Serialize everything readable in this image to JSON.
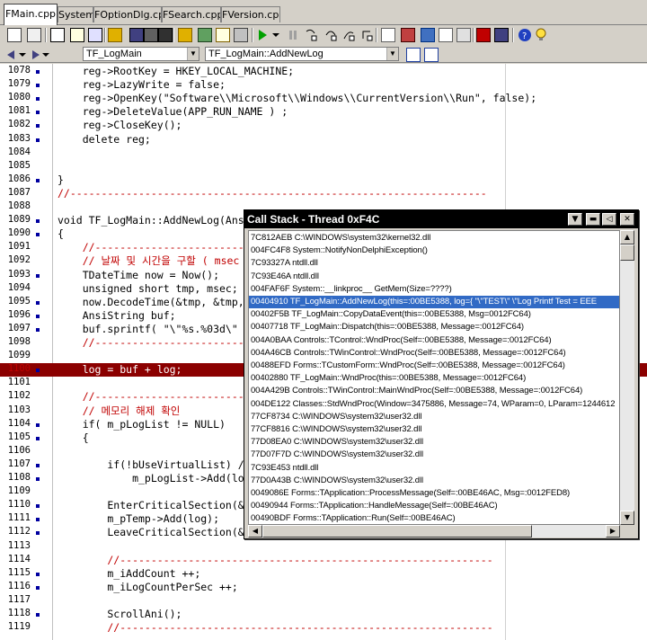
{
  "tabs": [
    "FMain.cpp",
    "System",
    "FOptionDlg.cpp",
    "FSearch.cpp",
    "FVersion.cpp"
  ],
  "nav": {
    "class_combo": "TF_LogMain",
    "method_combo": "TF_LogMain::AddNewLog"
  },
  "editor": {
    "lines": [
      {
        "n": "1078",
        "dot": true,
        "text": "    reg->RootKey = HKEY_LOCAL_MACHINE;"
      },
      {
        "n": "1079",
        "dot": true,
        "text": "    reg->LazyWrite = false;"
      },
      {
        "n": "1080",
        "dot": true,
        "text": "    reg->OpenKey(\"Software\\\\Microsoft\\\\Windows\\\\CurrentVersion\\\\Run\", false);"
      },
      {
        "n": "1081",
        "dot": true,
        "text": "    reg->DeleteValue(APP_RUN_NAME ) ;"
      },
      {
        "n": "1082",
        "dot": true,
        "text": "    reg->CloseKey();"
      },
      {
        "n": "1083",
        "dot": true,
        "text": "    delete reg;"
      },
      {
        "n": "1084",
        "dot": false,
        "text": ""
      },
      {
        "n": "1085",
        "dot": false,
        "text": ""
      },
      {
        "n": "1086",
        "dot": true,
        "text": "}"
      },
      {
        "n": "1087",
        "dot": false,
        "text": "//-------------------------------------------------------------------",
        "cm": true
      },
      {
        "n": "1088",
        "dot": false,
        "text": ""
      },
      {
        "n": "1089",
        "dot": true,
        "text": "void TF_LogMain::AddNewLog(AnsiSt"
      },
      {
        "n": "1090",
        "dot": true,
        "text": "{"
      },
      {
        "n": "1091",
        "dot": false,
        "text": "    //-----------------------------",
        "cm": true
      },
      {
        "n": "1092",
        "dot": false,
        "text": "    // 날짜 및 시간을 구할 ( msec",
        "cm": true
      },
      {
        "n": "1093",
        "dot": true,
        "text": "    TDateTime now = Now();"
      },
      {
        "n": "1094",
        "dot": false,
        "text": "    unsigned short tmp, msec;"
      },
      {
        "n": "1095",
        "dot": true,
        "text": "    now.DecodeTime(&tmp, &tmp, &tm"
      },
      {
        "n": "1096",
        "dot": true,
        "text": "    AnsiString buf;"
      },
      {
        "n": "1097",
        "dot": true,
        "text": "    buf.sprintf( \"\\\"%s.%03d\\\" \", "
      },
      {
        "n": "1098",
        "dot": false,
        "text": "    //-----------------------------",
        "cm": true
      },
      {
        "n": "1099",
        "dot": false,
        "text": ""
      },
      {
        "n": "1100",
        "dot": true,
        "text": "    log = buf + log;",
        "bp": true
      },
      {
        "n": "1101",
        "dot": false,
        "text": ""
      },
      {
        "n": "1102",
        "dot": false,
        "text": "    //-----------------------------",
        "cm": true
      },
      {
        "n": "1103",
        "dot": false,
        "text": "    // 메모리 해제 확인",
        "cm": true
      },
      {
        "n": "1104",
        "dot": true,
        "text": "    if( m_pLogList != NULL)"
      },
      {
        "n": "1105",
        "dot": true,
        "text": "    {"
      },
      {
        "n": "1106",
        "dot": false,
        "text": ""
      },
      {
        "n": "1107",
        "dot": true,
        "text": "        if(!bUseVirtualList) //Owne"
      },
      {
        "n": "1108",
        "dot": true,
        "text": "            m_pLogList->Add(log);"
      },
      {
        "n": "1109",
        "dot": false,
        "text": ""
      },
      {
        "n": "1110",
        "dot": true,
        "text": "        EnterCriticalSection(&g_sec"
      },
      {
        "n": "1111",
        "dot": true,
        "text": "        m_pTemp->Add(log);"
      },
      {
        "n": "1112",
        "dot": true,
        "text": "        LeaveCriticalSection(&g_sec"
      },
      {
        "n": "1113",
        "dot": false,
        "text": ""
      },
      {
        "n": "1114",
        "dot": false,
        "text": "        //------------------------------------------------------------",
        "cm": true
      },
      {
        "n": "1115",
        "dot": true,
        "text": "        m_iAddCount ++;"
      },
      {
        "n": "1116",
        "dot": true,
        "text": "        m_iLogCountPerSec ++;"
      },
      {
        "n": "1117",
        "dot": false,
        "text": ""
      },
      {
        "n": "1118",
        "dot": true,
        "text": "        ScrollAni();"
      },
      {
        "n": "1119",
        "dot": false,
        "text": "        //------------------------------------------------------------",
        "cm": true
      }
    ]
  },
  "callstack": {
    "title": "Call Stack - Thread 0xF4C",
    "selected_index": 5,
    "rows": [
      "7C812AEB C:\\WINDOWS\\system32\\kernel32.dll",
      "004FC4F8 System::NotifyNonDelphiException()",
      "7C93327A ntdll.dll",
      "7C93E46A ntdll.dll",
      "004FAF6F System::__linkproc__ GetMem(Size=????)",
      "00404910 TF_LogMain::AddNewLog(this=:00BE5388, log={ \"\\\"TEST\\\" \\\"Log Printf Test = EEE",
      "00402F5B TF_LogMain::CopyDataEvent(this=:00BE5388, Msg=0012FC64)",
      "00407718 TF_LogMain::Dispatch(this=:00BE5388, Message=:0012FC64)",
      "004A0BAA Controls::TControl::WndProc(Self=:00BE5388, Message=:0012FC64)",
      "004A46CB Controls::TWinControl::WndProc(Self=:00BE5388, Message=:0012FC64)",
      "00488EFD Forms::TCustomForm::WndProc(Self=:00BE5388, Message=:0012FC64)",
      "00402880 TF_LogMain::WndProc(this=:00BE5388, Message=:0012FC64)",
      "004A429B Controls::TWinControl::MainWndProc(Self=:00BE5388, Message=:0012FC64)",
      "004DE122 Classes::StdWndProc(Window=3475886, Message=74, WParam=0, LParam=1244612",
      "77CF8734 C:\\WINDOWS\\system32\\user32.dll",
      "77CF8816 C:\\WINDOWS\\system32\\user32.dll",
      "77D08EA0 C:\\WINDOWS\\system32\\user32.dll",
      "77D07F7D C:\\WINDOWS\\system32\\user32.dll",
      "7C93E453 ntdll.dll",
      "77D0A43B C:\\WINDOWS\\system32\\user32.dll",
      "0049086E Forms::TApplication::ProcessMessage(Self=:00BE46AC, Msg=:0012FED8)",
      "00490944 Forms::TApplication::HandleMessage(Self=:00BE46AC)",
      "00490BDF Forms::TApplication::Run(Self=:00BE46AC)"
    ]
  },
  "colors": {
    "breakpoint_line": "#8b0000",
    "comment": "#c00000",
    "selection": "#316ac5"
  }
}
